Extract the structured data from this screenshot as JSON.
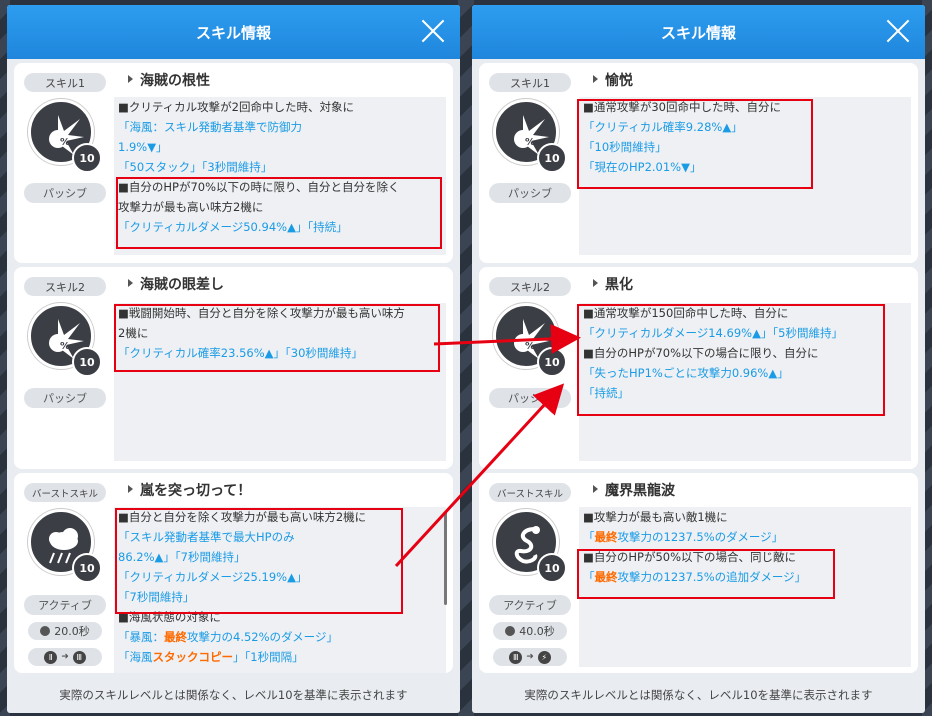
{
  "left": {
    "title": "スキル情報",
    "footer": "実際のスキルレベルとは関係なく、レベル10を基準に表示されます",
    "skill1": {
      "badge": "スキル1",
      "name": "海賊の根性",
      "level": "10",
      "type": "パッシブ",
      "lines": [
        [
          {
            "t": "■クリティカル攻撃が2回命中した時、対象に",
            "c": ""
          }
        ],
        [
          {
            "t": "「海風：スキル発動者基準で防御力",
            "c": "blue"
          }
        ],
        [
          {
            "t": "1.9%▼」",
            "c": "blue"
          }
        ],
        [
          {
            "t": "「50スタック」「3秒間維持」",
            "c": "blue"
          }
        ],
        [
          {
            "t": "■自分のHPが70%以下の時に限り、自分と自分を除く",
            "c": ""
          }
        ],
        [
          {
            "t": "攻撃力が最も高い味方2機に",
            "c": ""
          }
        ],
        [
          {
            "t": "「クリティカルダメージ50.94%▲」「持続」",
            "c": "blue"
          }
        ]
      ]
    },
    "skill2": {
      "badge": "スキル2",
      "name": "海賊の眼差し",
      "level": "10",
      "type": "パッシブ",
      "lines": [
        [
          {
            "t": "■戦闘開始時、自分と自分を除く攻撃力が最も高い味方",
            "c": ""
          }
        ],
        [
          {
            "t": "2機に",
            "c": ""
          }
        ],
        [
          {
            "t": "「クリティカル確率23.56%▲」「30秒間維持」",
            "c": "blue"
          }
        ]
      ]
    },
    "skill3": {
      "badge": "バーストスキル",
      "name": "嵐を突っ切って！",
      "level": "10",
      "type": "アクティブ",
      "cooldown": "20.0秒",
      "burst_from": "Ⅱ",
      "burst_to": "Ⅲ",
      "lines": [
        [
          {
            "t": "■自分と自分を除く攻撃力が最も高い味方2機に",
            "c": ""
          }
        ],
        [
          {
            "t": "「スキル発動者基準で最大HPのみ",
            "c": "blue"
          }
        ],
        [
          {
            "t": "86.2%▲」「7秒間維持」",
            "c": "blue"
          }
        ],
        [
          {
            "t": "「クリティカルダメージ25.19%▲」",
            "c": "blue"
          }
        ],
        [
          {
            "t": "「7秒間維持」",
            "c": "blue"
          }
        ],
        [
          {
            "t": "■海風状態の対象に",
            "c": ""
          }
        ],
        [
          {
            "t": "「暴風：",
            "c": "blue"
          },
          {
            "t": "最終",
            "c": "orange"
          },
          {
            "t": "攻撃力の4.52%のダメージ」",
            "c": "blue"
          }
        ],
        [
          {
            "t": "「海風",
            "c": "blue"
          },
          {
            "t": "スタックコピー",
            "c": "orange"
          },
          {
            "t": "」「1秒間隔」",
            "c": "blue"
          }
        ]
      ]
    }
  },
  "right": {
    "title": "スキル情報",
    "footer": "実際のスキルレベルとは関係なく、レベル10を基準に表示されます",
    "skill1": {
      "badge": "スキル1",
      "name": "愉悦",
      "level": "10",
      "type": "パッシブ",
      "lines": [
        [
          {
            "t": "■通常攻撃が30回命中した時、自分に",
            "c": ""
          }
        ],
        [
          {
            "t": "「クリティカル確率9.28%▲」",
            "c": "blue"
          }
        ],
        [
          {
            "t": "「10秒間維持」",
            "c": "blue"
          }
        ],
        [
          {
            "t": "「現在のHP2.01%▼」",
            "c": "blue"
          }
        ]
      ]
    },
    "skill2": {
      "badge": "スキル2",
      "name": "黒化",
      "level": "10",
      "type": "パッシブ",
      "lines": [
        [
          {
            "t": "■通常攻撃が150回命中した時、自分に",
            "c": ""
          }
        ],
        [
          {
            "t": "「クリティカルダメージ14.69%▲」「5秒間維持」",
            "c": "blue"
          }
        ],
        [
          {
            "t": "■自分のHPが70%以下の場合に限り、自分に",
            "c": ""
          }
        ],
        [
          {
            "t": "「失ったHP1%ごとに攻撃力0.96%▲」",
            "c": "blue"
          }
        ],
        [
          {
            "t": "「持続」",
            "c": "blue"
          }
        ]
      ]
    },
    "skill3": {
      "badge": "バーストスキル",
      "name": "魔界黒龍波",
      "level": "10",
      "type": "アクティブ",
      "cooldown": "40.0秒",
      "burst_from": "Ⅲ",
      "burst_to": "⚡",
      "lines": [
        [
          {
            "t": "■攻撃力が最も高い敵1機に",
            "c": ""
          }
        ],
        [
          {
            "t": "「",
            "c": "blue"
          },
          {
            "t": "最終",
            "c": "orange"
          },
          {
            "t": "攻撃力の1237.5%のダメージ」",
            "c": "blue"
          }
        ],
        [
          {
            "t": "■自分のHPが50%以下の場合、同じ敵に",
            "c": ""
          }
        ],
        [
          {
            "t": "「",
            "c": "blue"
          },
          {
            "t": "最終",
            "c": "orange"
          },
          {
            "t": "攻撃力の1237.5%の追加ダメージ」",
            "c": "blue"
          }
        ]
      ]
    }
  },
  "colors": {
    "header": "#1f8fe6",
    "highlight": "#e60012",
    "blue_text": "#1a9be6",
    "orange_text": "#ff6a00"
  }
}
